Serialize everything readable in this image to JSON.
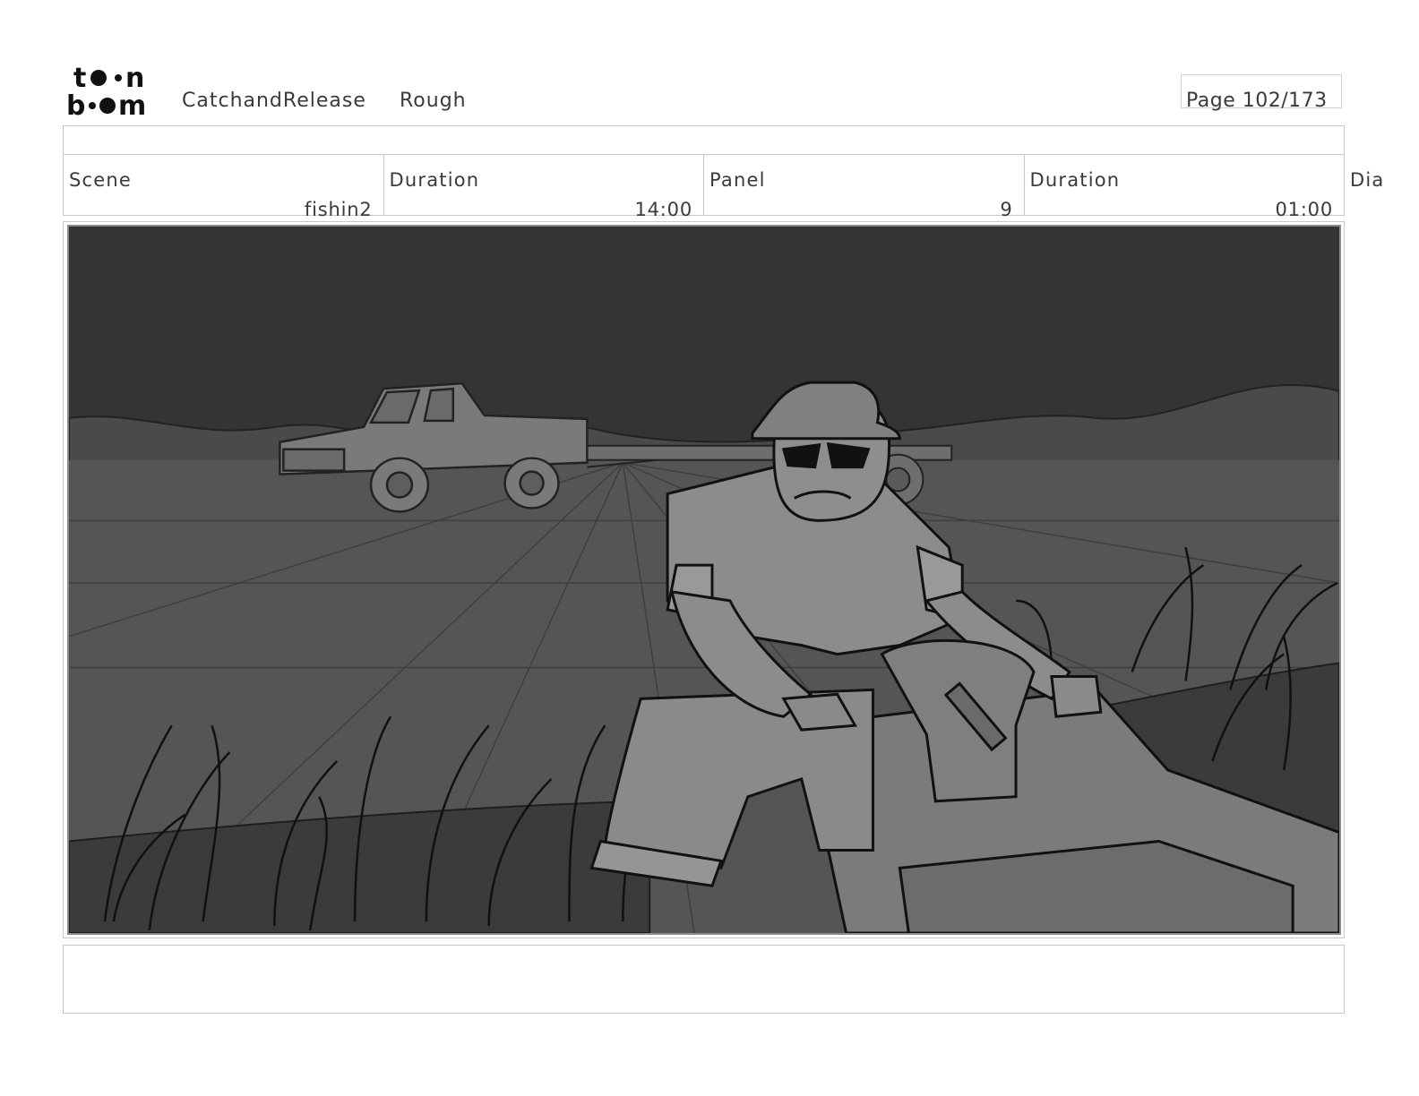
{
  "header": {
    "logo_text": "toon boom",
    "project_name": "CatchandRelease",
    "board_type": "Rough",
    "page": "Page 102/173"
  },
  "info": {
    "scene_label": "Scene",
    "scene_value": "fishin2",
    "scene_duration_label": "Duration",
    "scene_duration_value": "14:00",
    "panel_label": "Panel",
    "panel_value": "9",
    "panel_duration_label": "Duration",
    "panel_duration_value": "01:00",
    "dialog_label": "Dia"
  },
  "colors": {
    "sky": "#343434",
    "hills": "#4a4a4a",
    "field": "#555555",
    "grass": "#3a3a3a",
    "figure": "#8a8a8a",
    "boat": "#7b7b7b"
  },
  "notes": ""
}
